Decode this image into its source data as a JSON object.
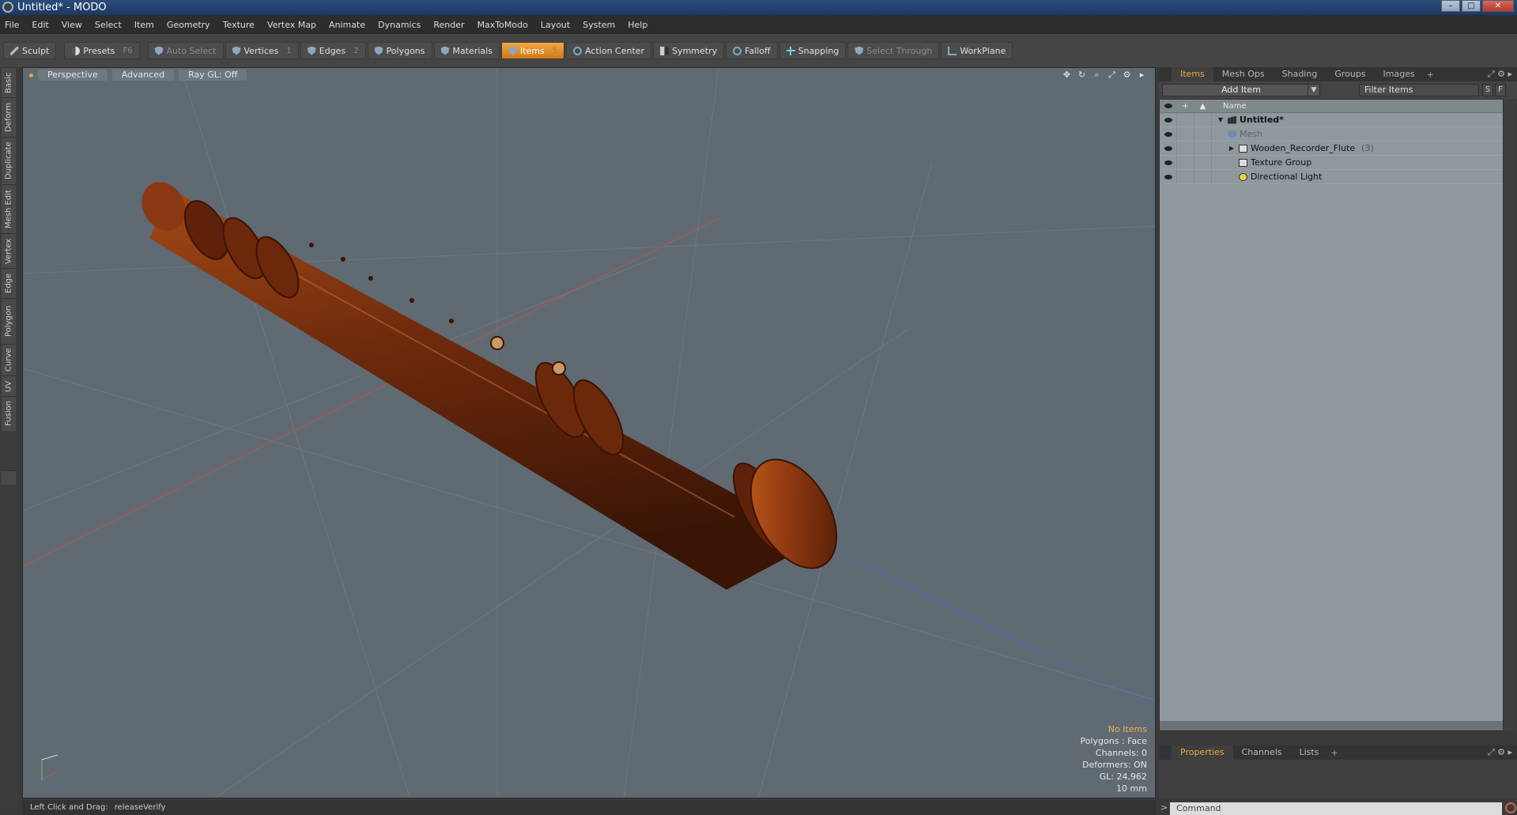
{
  "window": {
    "title": "Untitled* - MODO",
    "min": "–",
    "max": "□",
    "close": "✕"
  },
  "menu": [
    "File",
    "Edit",
    "View",
    "Select",
    "Item",
    "Geometry",
    "Texture",
    "Vertex Map",
    "Animate",
    "Dynamics",
    "Render",
    "MaxToModo",
    "Layout",
    "System",
    "Help"
  ],
  "toolbar": {
    "sculpt": "Sculpt",
    "presets": "Presets",
    "presets_key": "F6",
    "auto_select": "Auto Select",
    "vertices": "Vertices",
    "vertices_key": "1",
    "edges": "Edges",
    "edges_key": "2",
    "polygons": "Polygons",
    "materials": "Materials",
    "items": "Items",
    "items_key": "5",
    "action_center": "Action Center",
    "symmetry": "Symmetry",
    "falloff": "Falloff",
    "snapping": "Snapping",
    "select_through": "Select Through",
    "workplane": "WorkPlane"
  },
  "left_tabs": [
    "Basic",
    "Deform",
    "Duplicate",
    "Mesh Edit",
    "Vertex",
    "Edge",
    "Polygon",
    "Curve",
    "UV",
    "Fusion"
  ],
  "viewport": {
    "view": "Perspective",
    "mode": "Advanced",
    "raygl": "Ray GL: Off",
    "info": {
      "no_items": "No Items",
      "polygons": "Polygons : Face",
      "channels": "Channels: 0",
      "deformers": "Deformers: ON",
      "gl": "GL: 24,962",
      "scale": "10 mm"
    },
    "model_color": "#6e2a0c"
  },
  "status": {
    "hint": "Left Click and Drag:",
    "action": "releaseVerify"
  },
  "items_panel": {
    "tabs": [
      "Items",
      "Mesh Ops",
      "Shading",
      "Groups",
      "Images"
    ],
    "add_item": "Add Item",
    "filter": "Filter Items",
    "s_btn": "S",
    "f_btn": "F",
    "col_name": "Name",
    "rows": [
      {
        "label": "Untitled*",
        "icon": "scene-icon"
      },
      {
        "label": "Mesh",
        "icon": "mesh-icon"
      },
      {
        "label": "Wooden_Recorder_Flute",
        "count": "(3)",
        "icon": "group-icon"
      },
      {
        "label": "Texture Group",
        "icon": "group-icon"
      },
      {
        "label": "Directional Light",
        "icon": "light-icon"
      }
    ]
  },
  "props_panel": {
    "tabs": [
      "Properties",
      "Channels",
      "Lists"
    ],
    "command_placeholder": "Command"
  }
}
